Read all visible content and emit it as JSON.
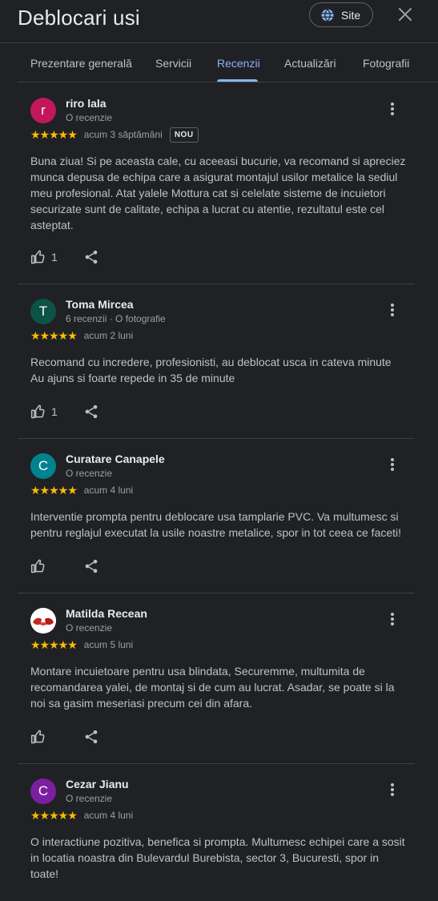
{
  "header": {
    "title": "Deblocari usi",
    "site_label": "Site"
  },
  "tabs": [
    {
      "label": "Prezentare generală"
    },
    {
      "label": "Servicii"
    },
    {
      "label": "Recenzii",
      "active": true
    },
    {
      "label": "Actualizări"
    },
    {
      "label": "Fotografii"
    }
  ],
  "colors": {
    "background": "#202124",
    "accent": "#8ab4f8",
    "star": "#fbbc04"
  },
  "reviews": [
    {
      "author": "riro lala",
      "meta": "O recenzie",
      "avatar_letter": "r",
      "avatar_color": "#c2185b",
      "rating": 5,
      "stars": "★★★★★",
      "time": "acum 3 săptămâni",
      "badge": "NOU",
      "text": "Buna ziua! Si pe aceasta cale, cu aceeasi bucurie, va recomand si apreciez munca depusa de echipa care a asigurat montajul usilor metalice la sediul meu profesional. Atat yalele Mottura cat si celelate sisteme de incuietori securizate sunt de calitate, echipa a lucrat cu atentie, rezultatul este cel asteptat.",
      "likes": "1"
    },
    {
      "author": "Toma Mircea",
      "meta": "6 recenzii · O fotografie",
      "avatar_letter": "T",
      "avatar_color": "#0b5345",
      "rating": 5,
      "stars": "★★★★★",
      "time": "acum 2 luni",
      "text": "Recomand cu incredere, profesionisti, au deblocat usca in cateva minute Au ajuns si foarte repede in 35 de minute",
      "likes": "1"
    },
    {
      "author": "Curatare Canapele",
      "meta": "O recenzie",
      "avatar_letter": "C",
      "avatar_color": "#00838f",
      "rating": 5,
      "stars": "★★★★★",
      "time": "acum 4 luni",
      "text": "Interventie prompta pentru deblocare usa tamplarie PVC. Va multumesc si pentru reglajul executat la usile noastre metalice, spor in tot ceea ce faceti!",
      "likes": ""
    },
    {
      "author": "Matilda Recean",
      "meta": "O recenzie",
      "avatar_letter": "",
      "avatar_color": "#ffffff",
      "rating": 5,
      "stars": "★★★★★",
      "time": "acum 5 luni",
      "text": "Montare incuietoare pentru usa blindata, Securemme, multumita de recomandarea yalei, de montaj si de cum au lucrat. Asadar, se poate si la noi sa gasim meseriasi precum cei din afara.",
      "likes": ""
    },
    {
      "author": "Cezar Jianu",
      "meta": "O recenzie",
      "avatar_letter": "C",
      "avatar_color": "#7b1fa2",
      "rating": 5,
      "stars": "★★★★★",
      "time": "acum 4 luni",
      "text": "O interactiune pozitiva, benefica si prompta. Multumesc echipei care a sosit in locatia noastra din Bulevardul Burebista, sector 3, Bucuresti, spor in toate!",
      "likes": ""
    }
  ]
}
